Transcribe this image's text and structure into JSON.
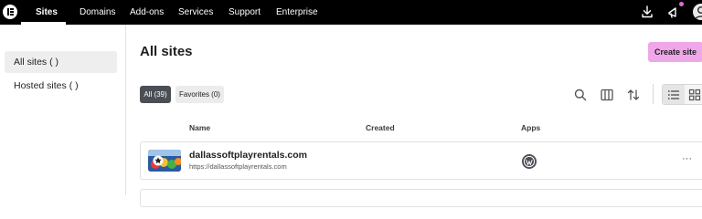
{
  "topnav": {
    "items": [
      {
        "label": "Sites"
      },
      {
        "label": "Domains"
      },
      {
        "label": "Add-ons"
      },
      {
        "label": "Services"
      },
      {
        "label": "Support"
      },
      {
        "label": "Enterprise"
      }
    ]
  },
  "sidebar": {
    "items": [
      {
        "label": "All sites (    )"
      },
      {
        "label": "Hosted sites (  )"
      }
    ]
  },
  "main": {
    "title": "All sites",
    "create_label": "Create site",
    "filters": [
      {
        "label": "All (39)"
      },
      {
        "label": "Favorites (0)"
      }
    ],
    "columns": [
      "Name",
      "Created",
      "Apps"
    ],
    "rows": [
      {
        "name": "dallassoftplayrentals.com",
        "url": "https://dallassoftplayrentals.com",
        "created": "",
        "more": "···"
      }
    ]
  },
  "colors": {
    "topbar": "#000000",
    "accent_button": "#f0a7ea",
    "active_chip": "#4a4e55",
    "notification_dot": "#e36bd1"
  },
  "icons": [
    "elementor-logo-icon",
    "download-icon",
    "whats-new-icon",
    "user-avatar-icon",
    "search-icon",
    "columns-icon",
    "sort-icon",
    "list-view-icon",
    "grid-view-icon",
    "wordpress-icon",
    "more-icon"
  ]
}
